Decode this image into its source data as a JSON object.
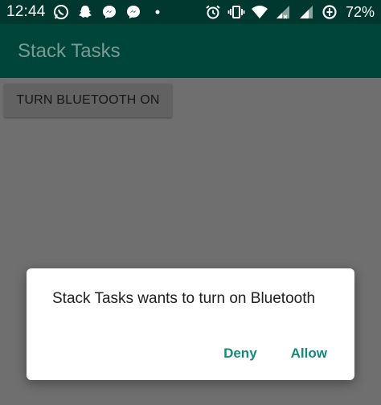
{
  "status_bar": {
    "time": "12:44",
    "left_icons": [
      "whatsapp-icon",
      "snapchat-icon",
      "messenger-icon",
      "messenger-icon",
      "dot-icon"
    ],
    "right_icons": [
      "alarm-icon",
      "vibrate-icon",
      "wifi-icon",
      "signal-icon",
      "signal-icon",
      "data-saver-icon"
    ],
    "battery": "72%"
  },
  "app_bar": {
    "title": "Stack Tasks"
  },
  "main": {
    "bluetooth_button": "TURN BLUETOOTH ON"
  },
  "dialog": {
    "message": "Stack Tasks wants to turn on Bluetooth",
    "deny_label": "Deny",
    "allow_label": "Allow"
  },
  "colors": {
    "status_bar": "#00382f",
    "app_bar": "#00453a",
    "accent": "#138a7b",
    "scrim_background": "#6f6f6f"
  }
}
